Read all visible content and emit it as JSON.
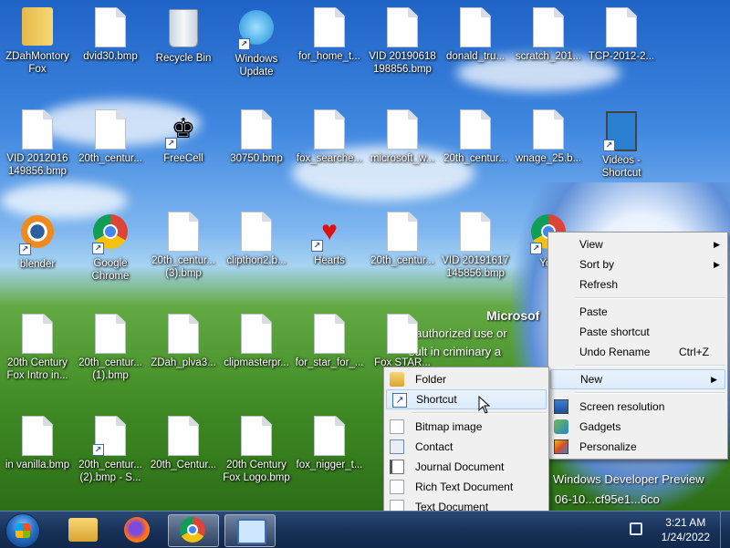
{
  "desktop": {
    "icons": [
      {
        "label": "ZDahMontory\nFox",
        "type": "folder",
        "shortcut": false
      },
      {
        "label": "dvid30.bmp",
        "type": "file",
        "shortcut": false
      },
      {
        "label": "Recycle Bin",
        "type": "recycle",
        "shortcut": false
      },
      {
        "label": "Windows\nUpdate",
        "type": "update",
        "shortcut": true
      },
      {
        "label": "for_home_t...",
        "type": "file",
        "shortcut": false
      },
      {
        "label": "VID 20190618\n198856.bmp",
        "type": "file",
        "shortcut": false
      },
      {
        "label": "donald_tru...",
        "type": "file",
        "shortcut": false
      },
      {
        "label": "scratch_201...",
        "type": "file",
        "shortcut": false
      },
      {
        "label": "TCP-2012-2...",
        "type": "file",
        "shortcut": false
      },
      {
        "label": "VID 2012016\n149856.bmp",
        "type": "file",
        "shortcut": false
      },
      {
        "label": "20th_centur...",
        "type": "file",
        "shortcut": false
      },
      {
        "label": "FreeCell",
        "type": "freecell",
        "shortcut": true
      },
      {
        "label": "30750.bmp",
        "type": "file",
        "shortcut": false
      },
      {
        "label": "fox_searche...",
        "type": "file",
        "shortcut": false
      },
      {
        "label": "microsoft_w...",
        "type": "file",
        "shortcut": false
      },
      {
        "label": "20th_centur...",
        "type": "file",
        "shortcut": false
      },
      {
        "label": "wnage_25.b...",
        "type": "file",
        "shortcut": false
      },
      {
        "label": "Videos -\nShortcut",
        "type": "videos",
        "shortcut": true
      },
      {
        "label": "blender",
        "type": "blender",
        "shortcut": true
      },
      {
        "label": "Google\nChrome",
        "type": "chrome",
        "shortcut": true
      },
      {
        "label": "20th_centur...\n(3).bmp",
        "type": "file",
        "shortcut": false
      },
      {
        "label": "clipthon2.b...",
        "type": "file",
        "shortcut": false
      },
      {
        "label": "Hearts",
        "type": "hearts",
        "shortcut": true
      },
      {
        "label": "20th_centur...",
        "type": "file",
        "shortcut": false
      },
      {
        "label": "VID 20191617\n145856.bmp",
        "type": "file",
        "shortcut": false
      },
      {
        "label": "You",
        "type": "chrome",
        "shortcut": true
      },
      {
        "label": "20th Century\nFox Intro in...",
        "type": "file",
        "shortcut": false
      },
      {
        "label": "20th_centur...\n(1).bmp",
        "type": "file",
        "shortcut": false
      },
      {
        "label": "ZDah_plva3...",
        "type": "file",
        "shortcut": false
      },
      {
        "label": "clipmasterpr...",
        "type": "file",
        "shortcut": false
      },
      {
        "label": "for_star_for_...",
        "type": "file",
        "shortcut": false
      },
      {
        "label": "Fox STAR...",
        "type": "file",
        "shortcut": false
      },
      {
        "label": "in vanilla.bmp",
        "type": "file",
        "shortcut": false
      },
      {
        "label": "20th_centur...\n(2).bmp - S...",
        "type": "file",
        "shortcut": true
      },
      {
        "label": "20th_Centur...",
        "type": "file",
        "shortcut": false
      },
      {
        "label": "20th Century\nFox Logo.bmp",
        "type": "file",
        "shortcut": false
      },
      {
        "label": "fox_nigger_t...",
        "type": "file",
        "shortcut": false
      }
    ],
    "watermark": {
      "microsoft": "Microsof",
      "unauth": "nauthorized use or",
      "result": "sult in criminary a",
      "preview": "Windows Developer Preview",
      "build": "06-10...cf95e1...6co"
    }
  },
  "context_menu": {
    "items": [
      {
        "label": "View",
        "submenu": true
      },
      {
        "label": "Sort by",
        "submenu": true
      },
      {
        "label": "Refresh"
      },
      {
        "sep": true
      },
      {
        "label": "Paste"
      },
      {
        "label": "Paste shortcut"
      },
      {
        "label": "Undo Rename",
        "accel": "Ctrl+Z"
      },
      {
        "sep": true
      },
      {
        "label": "New",
        "submenu": true,
        "highlight": true
      },
      {
        "sep": true
      },
      {
        "label": "Screen resolution",
        "icon": "monitor"
      },
      {
        "label": "Gadgets",
        "icon": "gadget"
      },
      {
        "label": "Personalize",
        "icon": "personalize"
      }
    ]
  },
  "new_submenu": {
    "items": [
      {
        "label": "Folder",
        "icon": "folder"
      },
      {
        "label": "Shortcut",
        "icon": "shortcut",
        "highlight": true
      },
      {
        "sep": true
      },
      {
        "label": "Bitmap image",
        "icon": "doc"
      },
      {
        "label": "Contact",
        "icon": "contact"
      },
      {
        "label": "Journal Document",
        "icon": "journal"
      },
      {
        "label": "Rich Text Document",
        "icon": "doc"
      },
      {
        "label": "Text Document",
        "icon": "doc"
      }
    ]
  },
  "taskbar": {
    "time": "3:21 AM",
    "date": "1/24/2022",
    "buttons": [
      "explorer-icon",
      "firefox-icon",
      "chrome-icon",
      "control-panel-icon"
    ]
  },
  "colors": {
    "menu_bg": "#f0f0f0",
    "highlight_border": "#a8cdf0",
    "taskbar": "#18325a"
  }
}
